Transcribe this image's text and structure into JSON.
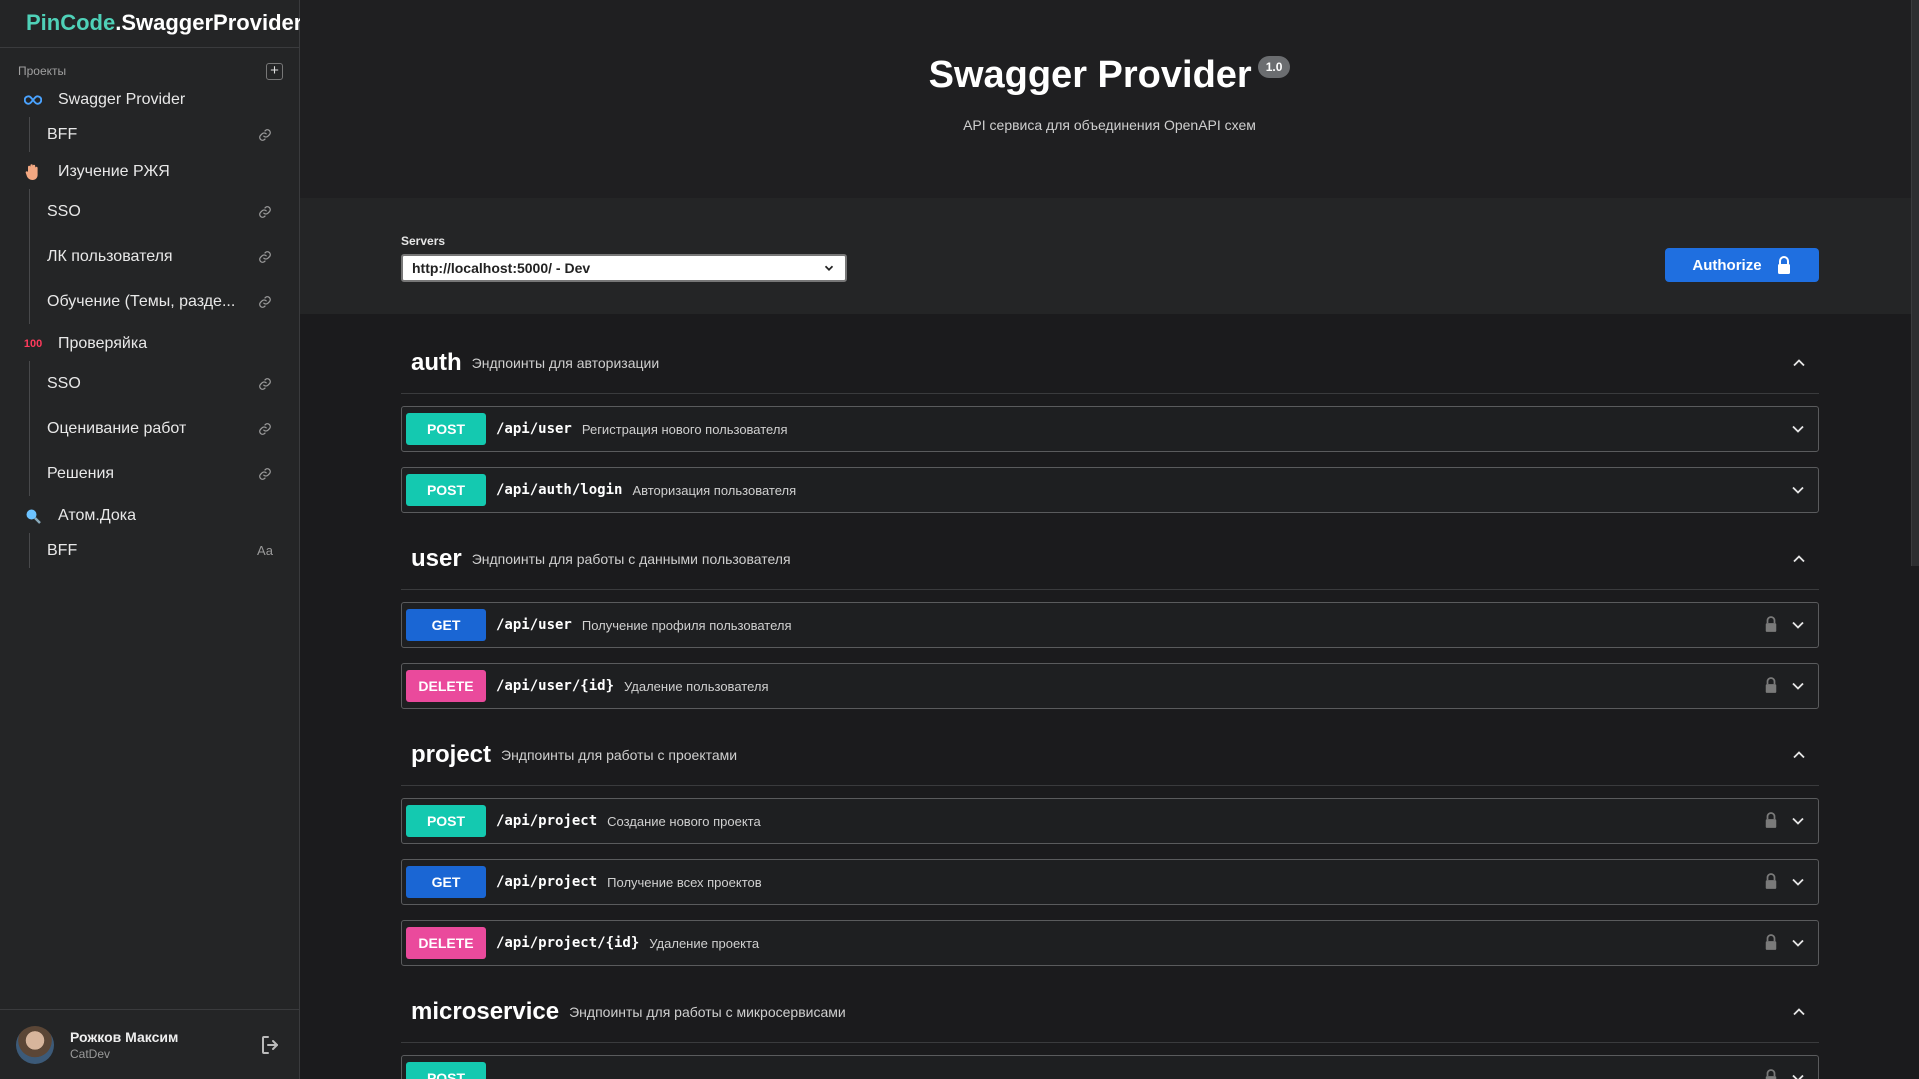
{
  "brand": {
    "accent": "PinCode",
    "rest": ".SwaggerProvider"
  },
  "sidebar": {
    "section_title": "Проекты",
    "projects": [
      {
        "icon": "infinity-icon",
        "label": "Swagger Provider",
        "children": [
          {
            "label": "BFF",
            "icon": "link-icon"
          }
        ]
      },
      {
        "icon": "hand-icon",
        "label": "Изучение РЖЯ",
        "children": [
          {
            "label": "SSO",
            "icon": "link-icon"
          },
          {
            "label": "ЛК пользователя",
            "icon": "link-icon"
          },
          {
            "label": "Обучение (Темы, разде...",
            "icon": "link-icon"
          }
        ]
      },
      {
        "icon": "hundred-icon",
        "label": "Проверяйка",
        "children": [
          {
            "label": "SSO",
            "icon": "link-icon"
          },
          {
            "label": "Оценивание работ",
            "icon": "link-icon"
          },
          {
            "label": "Решения",
            "icon": "link-icon"
          }
        ]
      },
      {
        "icon": "magnifier-icon",
        "label": "Атом.Дока",
        "children": [
          {
            "label": "BFF",
            "icon": "font-icon"
          }
        ]
      }
    ],
    "font_icon_text": "Aa"
  },
  "user": {
    "name": "Рожков Максим",
    "role": "CatDev"
  },
  "info": {
    "title": "Swagger Provider",
    "version": "1.0",
    "description": "API сервиса для объединения OpenAPI схем"
  },
  "servers": {
    "label": "Servers",
    "selected": "http://localhost:5000/ - Dev"
  },
  "authorize": {
    "label": "Authorize"
  },
  "tags": [
    {
      "name": "auth",
      "description": "Эндпоинты для авторизации",
      "ops": [
        {
          "method": "POST",
          "path": "/api/user",
          "summary": "Регистрация нового пользователя",
          "locked": false
        },
        {
          "method": "POST",
          "path": "/api/auth/login",
          "summary": "Авторизация пользователя",
          "locked": false
        }
      ]
    },
    {
      "name": "user",
      "description": "Эндпоинты для работы с данными пользователя",
      "ops": [
        {
          "method": "GET",
          "path": "/api/user",
          "summary": "Получение профиля пользователя",
          "locked": true
        },
        {
          "method": "DELETE",
          "path": "/api/user/{id}",
          "summary": "Удаление пользователя",
          "locked": true
        }
      ]
    },
    {
      "name": "project",
      "description": "Эндпоинты для работы с проектами",
      "ops": [
        {
          "method": "POST",
          "path": "/api/project",
          "summary": "Создание нового проекта",
          "locked": true
        },
        {
          "method": "GET",
          "path": "/api/project",
          "summary": "Получение всех проектов",
          "locked": true
        },
        {
          "method": "DELETE",
          "path": "/api/project/{id}",
          "summary": "Удаление проекта",
          "locked": true
        }
      ]
    },
    {
      "name": "microservice",
      "description": "Эндпоинты для работы с микросервисами",
      "ops": [
        {
          "method": "POST",
          "path": "",
          "summary": "",
          "locked": true
        }
      ]
    }
  ],
  "colors": {
    "post": "#14c9b0",
    "get": "#1a66d4",
    "delete": "#ea4a9c",
    "accent": "#4fd1b8",
    "authorize": "#1f6fe0"
  }
}
